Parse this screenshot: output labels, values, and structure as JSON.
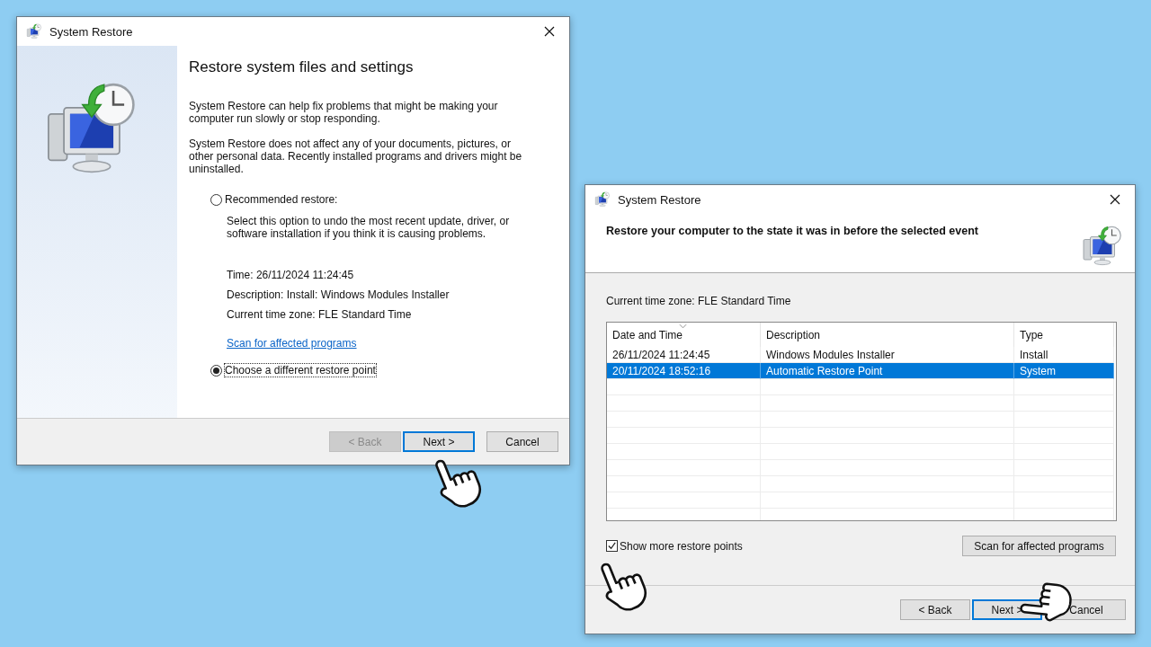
{
  "restore_wizard": {
    "title": "System Restore",
    "heading": "Restore system files and settings",
    "paragraphs": [
      "System Restore can help fix problems that might be making your computer run slowly or stop responding.",
      "System Restore does not affect any of your documents, pictures, or other personal data. Recently installed programs and drivers might be uninstalled."
    ],
    "options": [
      {
        "label": "Recommended restore:",
        "selected": false
      },
      {
        "label": "Choose a different restore point",
        "selected": true
      }
    ],
    "recommended_description": "Select this option to undo the most recent update, driver, or software installation if you think it is causing problems.",
    "details": [
      "Time: 26/11/2024 11:24:45",
      "Description: Install: Windows Modules Installer",
      "Current time zone: FLE Standard Time"
    ],
    "link": "Scan for affected programs",
    "buttons": [
      {
        "label": "< Back",
        "disabled": true,
        "default": false
      },
      {
        "label": "Next >",
        "disabled": false,
        "default": true
      },
      {
        "label": "Cancel",
        "disabled": false,
        "default": false
      }
    ]
  },
  "restore_point_dialog": {
    "title": "System Restore",
    "heading": "Restore your computer to the state it was in before the selected event",
    "timezone": "Current time zone: FLE Standard Time",
    "columns": [
      "Date and Time",
      "Description",
      "Type"
    ],
    "rows": [
      {
        "cells": [
          "26/11/2024 11:24:45",
          "Windows Modules Installer",
          "Install"
        ],
        "selected": false
      },
      {
        "cells": [
          "20/11/2024 18:52:16",
          "Automatic Restore Point",
          "System"
        ],
        "selected": true
      }
    ],
    "show_more": {
      "label": "Show more restore points",
      "checked": true
    },
    "scan_button": "Scan for affected programs",
    "buttons": [
      {
        "label": "< Back",
        "disabled": false,
        "default": false
      },
      {
        "label": "Next >",
        "disabled": false,
        "default": true
      },
      {
        "label": "Cancel",
        "disabled": false,
        "default": false
      }
    ]
  }
}
